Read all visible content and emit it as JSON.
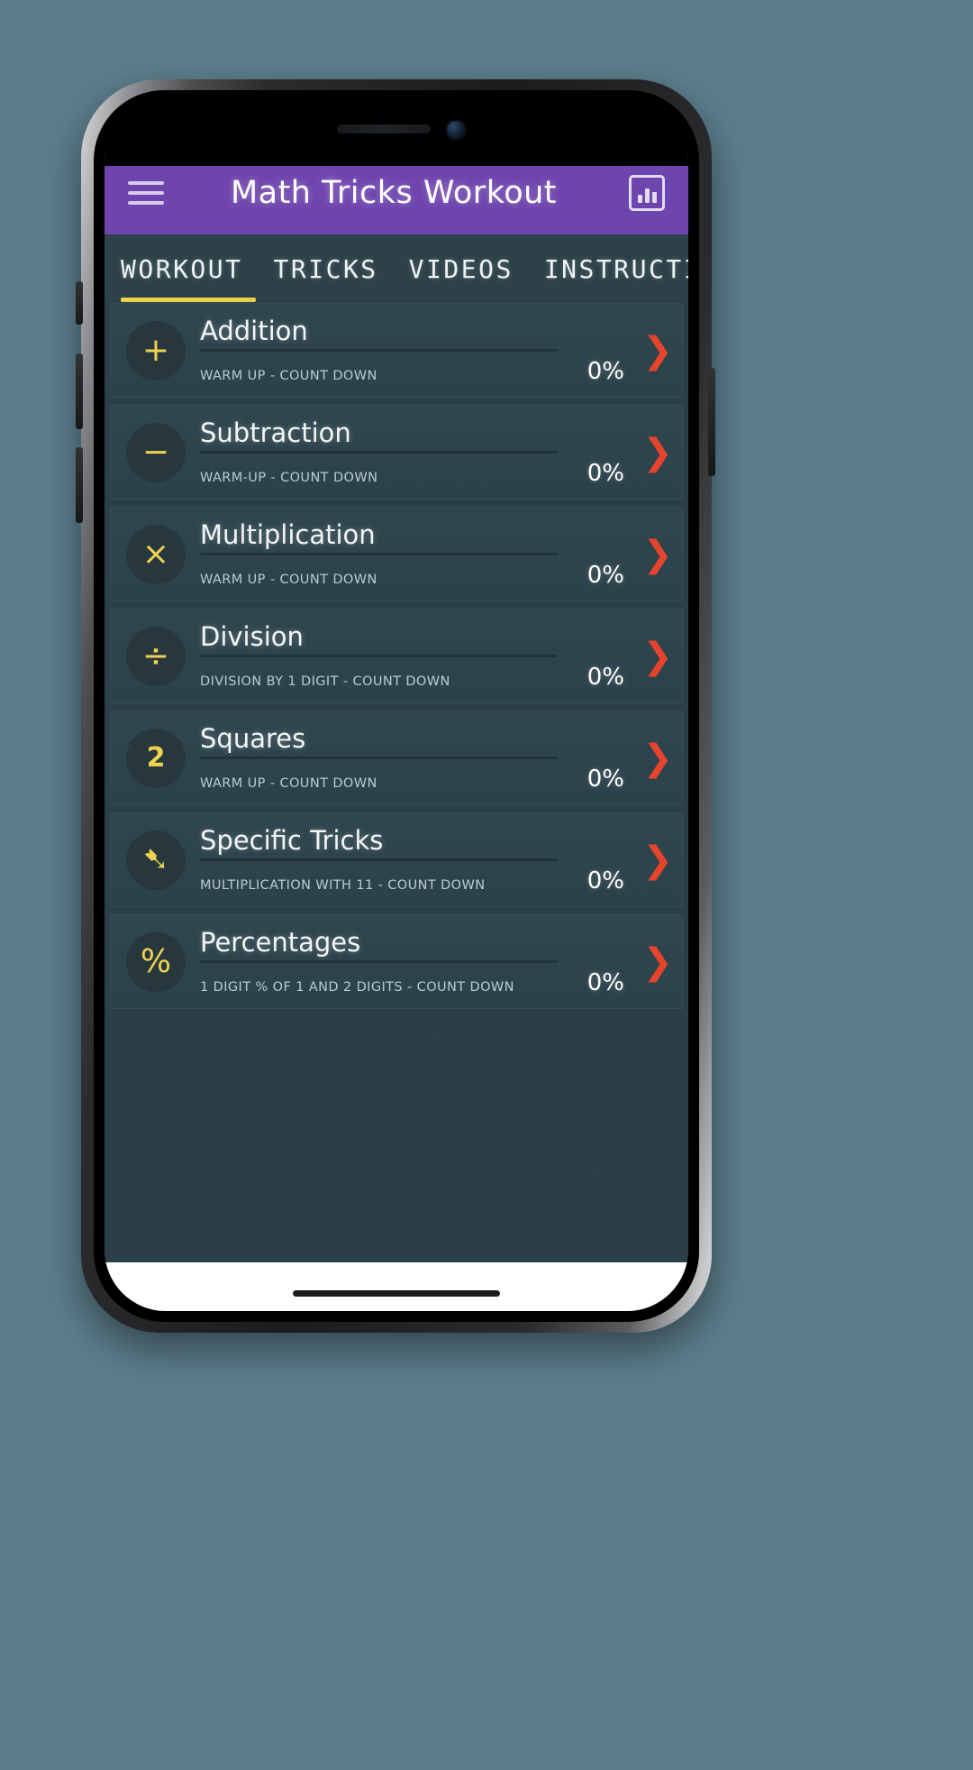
{
  "app_bar": {
    "menu_icon": "hamburger-menu-icon",
    "title": "Math Tricks Workout",
    "stats_icon": "bar-chart-icon",
    "background_color": "#6e45ae"
  },
  "tabs": {
    "active_index": 0,
    "active_underline_color": "#ead14a",
    "items": [
      {
        "label": "WORKOUT"
      },
      {
        "label": "TRICKS"
      },
      {
        "label": "VIDEOS"
      },
      {
        "label": "INSTRUCTIONS"
      }
    ]
  },
  "workout_list": {
    "chevron_color": "#e8442c",
    "badge_symbol_color": "#efd24f",
    "rows": [
      {
        "title": "Addition",
        "badge_symbol": "+",
        "badge_icon": "plus-icon",
        "subtitle": "WARM UP - COUNT DOWN",
        "percent": "0%"
      },
      {
        "title": "Subtraction",
        "badge_symbol": "−",
        "badge_icon": "minus-icon",
        "subtitle": "WARM-UP - COUNT DOWN",
        "percent": "0%"
      },
      {
        "title": "Multiplication",
        "badge_symbol": "×",
        "badge_icon": "multiply-icon",
        "subtitle": "WARM UP - COUNT DOWN",
        "percent": "0%"
      },
      {
        "title": "Division",
        "badge_symbol": "÷",
        "badge_icon": "divide-icon",
        "subtitle": "DIVISION BY 1 DIGIT - COUNT DOWN",
        "percent": "0%"
      },
      {
        "title": "Squares",
        "badge_symbol": "2",
        "badge_icon": "square-exponent-icon",
        "subtitle": "WARM UP - COUNT DOWN",
        "percent": "0%"
      },
      {
        "title": "Specific Tricks",
        "badge_symbol": "➷",
        "badge_icon": "arrow-trick-icon",
        "subtitle": "MULTIPLICATION WITH 11 - COUNT DOWN",
        "percent": "0%"
      },
      {
        "title": "Percentages",
        "badge_symbol": "%",
        "badge_icon": "percent-icon",
        "subtitle": "1 DIGIT % OF 1 AND 2 DIGITS - COUNT DOWN",
        "percent": "0%"
      }
    ]
  }
}
